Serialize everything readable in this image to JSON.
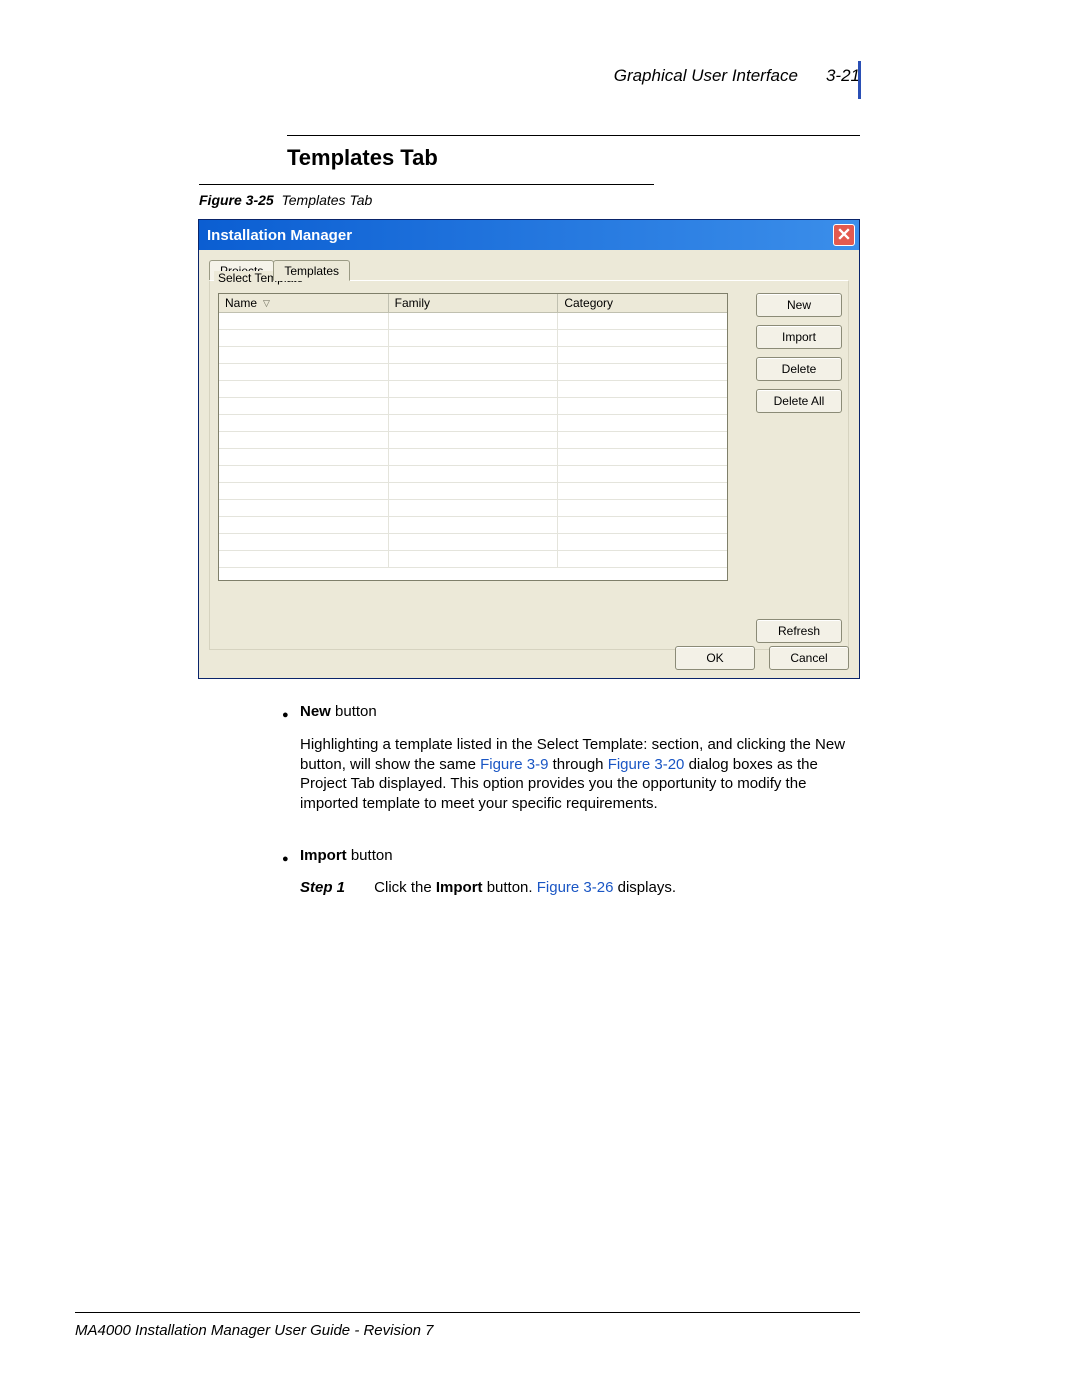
{
  "header": {
    "section": "Graphical User Interface",
    "pagenum": "3-21"
  },
  "section_title": "Templates Tab",
  "figure": {
    "label": "Figure 3-25",
    "text": "Templates Tab"
  },
  "dialog": {
    "title": "Installation Manager",
    "tabs": [
      "Projects",
      "Templates"
    ],
    "active_tab": 1,
    "group_legend": "Select Template",
    "columns": [
      "Name",
      "Family",
      "Category"
    ],
    "row_count": 15,
    "side_buttons": [
      "New",
      "Import",
      "Delete",
      "Delete All"
    ],
    "refresh": "Refresh",
    "footer_buttons": [
      "OK",
      "Cancel"
    ]
  },
  "bullets": {
    "new_label": "New",
    "new_suffix": " button",
    "new_body_pre": "Highlighting a template listed in the Select Template: section, and clicking the New button, will show the same ",
    "new_link1": "Figure 3-9",
    "new_mid": " through ",
    "new_link2": "Figure 3-20",
    "new_body_post": " dialog boxes as the Project Tab displayed. This option provides you the opportunity to modify the imported template to meet your specific requirements.",
    "import_label": "Import",
    "import_suffix": " button",
    "step_label": "Step 1",
    "step_body_pre": "Click the ",
    "step_bold": "Import",
    "step_body_mid": " button. ",
    "step_link": "Figure 3-26",
    "step_body_post": " displays."
  },
  "footer": "MA4000 Installation Manager User Guide - Revision 7"
}
